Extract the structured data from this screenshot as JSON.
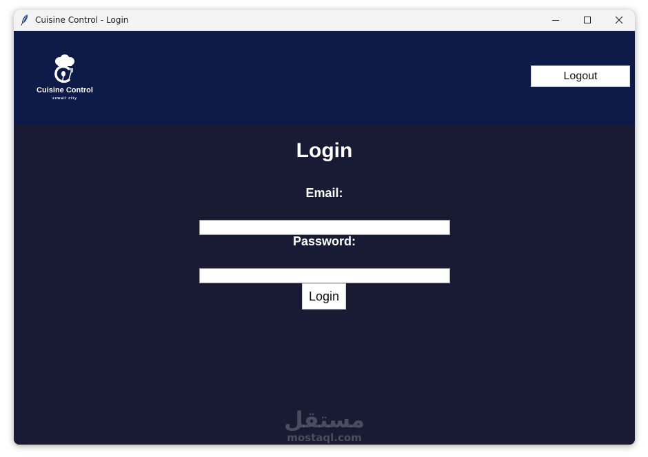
{
  "window": {
    "title": "Cuisine Control - Login",
    "icon": "feather-icon",
    "controls": {
      "minimize": "minimize-icon",
      "maximize": "maximize-icon",
      "close": "close-icon"
    }
  },
  "header": {
    "logo_name": "Cuisine Control",
    "logo_subtitle": "zewail city",
    "logo_icon": "chef-hat-icon",
    "logout_label": "Logout"
  },
  "form": {
    "title": "Login",
    "email_label": "Email:",
    "email_value": "",
    "password_label": "Password:",
    "password_value": "",
    "submit_label": "Login"
  },
  "watermark": {
    "arabic": "مستقل",
    "latin": "mostaql.com"
  },
  "colors": {
    "header_bg": "#0e1b48",
    "body_bg": "#181b33",
    "text": "#ffffff",
    "button_bg": "#ffffff"
  }
}
